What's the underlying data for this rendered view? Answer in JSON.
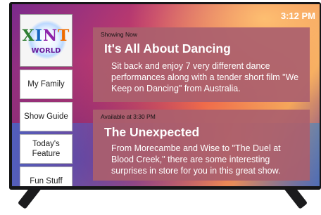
{
  "clock": "3:12 PM",
  "logo": {
    "title": "XINT",
    "subtitle": "WORLD"
  },
  "menu": {
    "items": [
      {
        "label": "My Family"
      },
      {
        "label": "Show Guide"
      },
      {
        "label": "Today's Feature"
      },
      {
        "label": "Fun Stuff"
      }
    ]
  },
  "now_showing": {
    "label": "Showing Now",
    "title": "It's All About Dancing",
    "description": "Sit back and enjoy 7 very different dance performances along with a tender short film \"We Keep on Dancing\" from Australia."
  },
  "up_next": {
    "label": "Available at 3:30 PM",
    "title": "The Unexpected",
    "description": "From Morecambe and Wise to \"The Duel at Blood Creek,\" there are some interesting surprises in store for you in this great show."
  },
  "colors": {
    "card": "#aa606e",
    "tv_frame": "#161618",
    "logo_red": "#c0392b"
  }
}
